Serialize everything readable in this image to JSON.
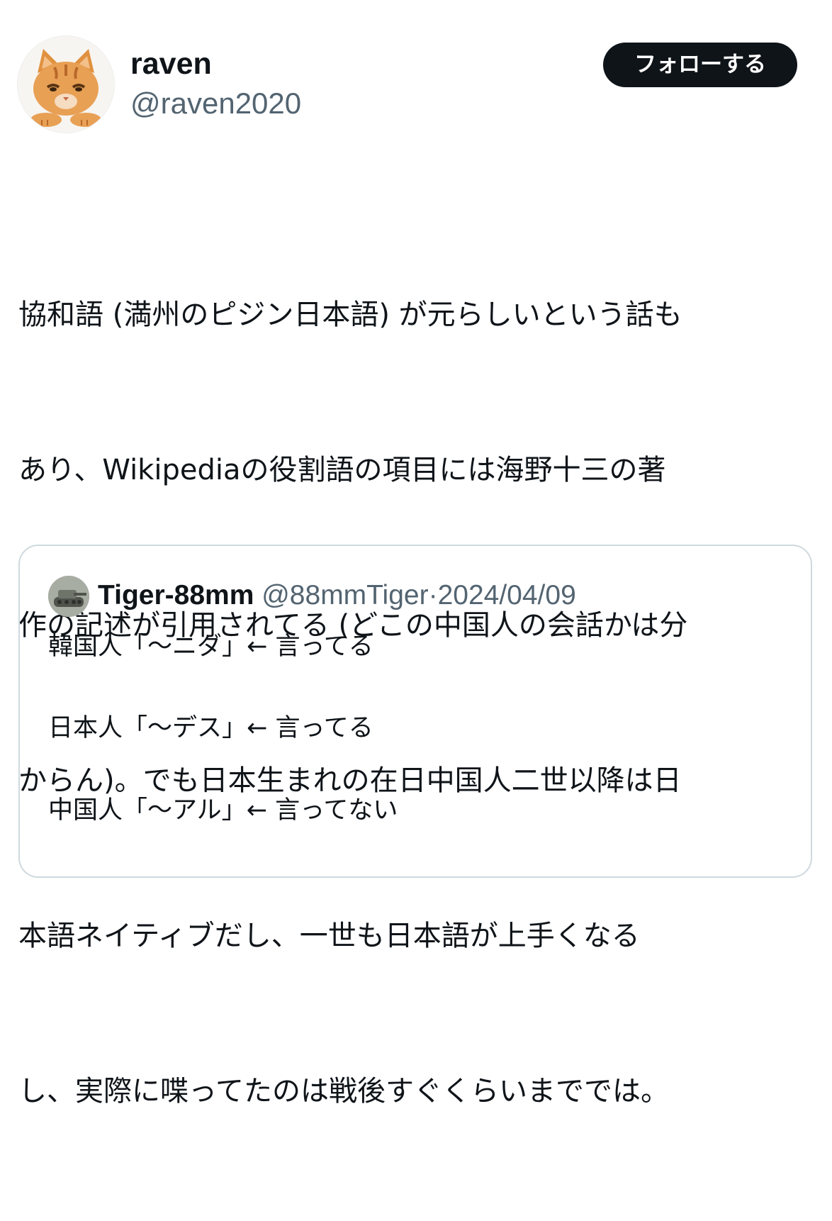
{
  "author": {
    "display_name": "raven",
    "handle": "@raven2020",
    "avatar_icon": "orange-cat-avatar"
  },
  "follow_button": {
    "label": "フォローする"
  },
  "tweet_lines": [
    "協和語 (満州のピジン日本語) が元らしいという話も",
    "あり、Wikipediaの役割語の項目には海野十三の著",
    "作の記述が引用されてる (どこの中国人の会話かは分",
    "からん)。でも日本生まれの在日中国人二世以降は日",
    "本語ネイティブだし、一世も日本語が上手くなる",
    "し、実際に喋ってたのは戦後すぐくらいまででは。"
  ],
  "quoted_post": {
    "display_name": "Tiger-88mm",
    "handle": "@88mmTiger",
    "separator": "·",
    "date": "2024/04/09",
    "avatar_icon": "tank-avatar",
    "lines": [
      "韓国人「〜ニダ」← 言ってる",
      "日本人「〜デス」← 言ってる",
      "中国人「〜アル」← 言ってない"
    ]
  },
  "colors": {
    "text": "#0f1419",
    "secondary": "#536471",
    "button_bg": "#0f1419",
    "button_text": "#ffffff",
    "border": "#cfd9de"
  }
}
